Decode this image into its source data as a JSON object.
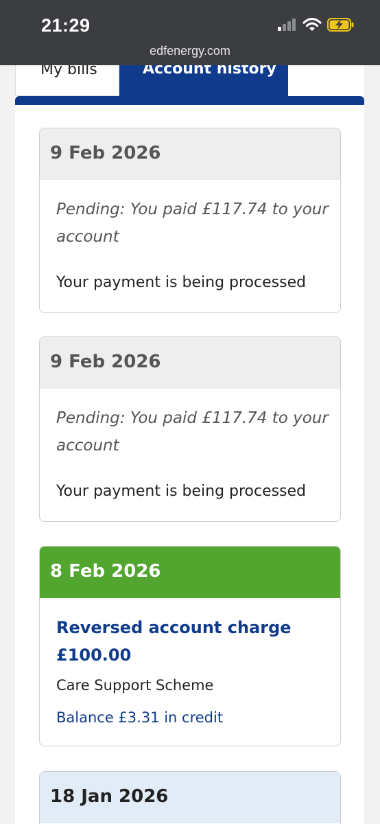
{
  "status_bar": {
    "time": "21:29",
    "url": "edfenergy.com"
  },
  "tabs": {
    "my_bills": "My bills",
    "account_history": "Account history"
  },
  "colors": {
    "brand_blue": "#103b8c",
    "credit_green": "#52a52f"
  },
  "entries": [
    {
      "date": "9 Feb 2026",
      "description": "Pending: You paid £117.74 to your account",
      "status": "Your payment is being processed"
    },
    {
      "date": "9 Feb 2026",
      "description": "Pending: You paid £117.74 to your account",
      "status": "Your payment is being processed"
    },
    {
      "date": "8 Feb 2026",
      "title": "Reversed account charge £100.00",
      "subtitle": "Care Support Scheme",
      "balance": "Balance £3.31 in credit"
    },
    {
      "date": "18 Jan 2026"
    }
  ]
}
